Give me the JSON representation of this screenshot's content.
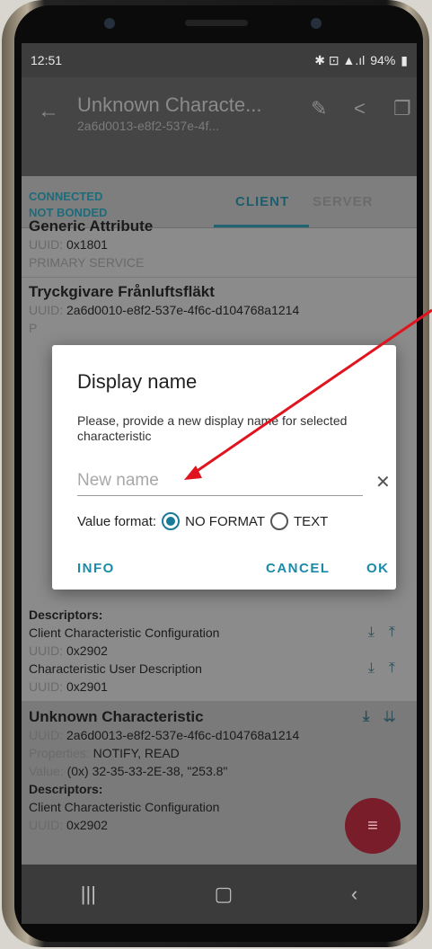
{
  "status": {
    "time": "12:51",
    "battery": "94%"
  },
  "appbar": {
    "title": "Unknown Characte...",
    "subtitle": "2a6d0013-e8f2-537e-4f..."
  },
  "connection": {
    "line1": "CONNECTED",
    "line2": "NOT BONDED"
  },
  "tabs": {
    "client": "CLIENT",
    "server": "SERVER"
  },
  "content": {
    "service1": {
      "name": "Generic Attribute",
      "uuid_label": "UUID:",
      "uuid": "0x1801",
      "type": "PRIMARY SERVICE"
    },
    "service2": {
      "name": "Tryckgivare Frånluftsfläkt",
      "uuid_label": "UUID:",
      "uuid": "2a6d0010-e8f2-537e-4f6c-d104768a1214",
      "type": "P"
    },
    "descriptors_label": "Descriptors:",
    "desc1": {
      "name": "Client Characteristic Configuration",
      "uuid_label": "UUID:",
      "uuid": "0x2902"
    },
    "desc2": {
      "name": "Characteristic User Description",
      "uuid_label": "UUID:",
      "uuid": "0x2901"
    },
    "char3": {
      "name": "Unknown Characteristic",
      "uuid_label": "UUID:",
      "uuid": "2a6d0013-e8f2-537e-4f6c-d104768a1214",
      "props_label": "Properties:",
      "props": "NOTIFY, READ",
      "value_label": "Value:",
      "value": "(0x) 32-35-33-2E-38, \"253.8\"",
      "descriptors_label": "Descriptors:",
      "desc_name": "Client Characteristic Configuration",
      "desc_uuid_label": "UUID:",
      "desc_uuid": "0x2902"
    }
  },
  "dialog": {
    "title": "Display name",
    "message": "Please, provide a new display name for selected characteristic",
    "input_placeholder": "New name",
    "format_label": "Value format:",
    "opt_no_format": "NO FORMAT",
    "opt_text": "TEXT",
    "btn_info": "INFO",
    "btn_cancel": "CANCEL",
    "btn_ok": "OK"
  },
  "colors": {
    "accent": "#1a8aa8",
    "annotation_arrow": "#e0141e",
    "fab": "#7a1d2b"
  },
  "icons": [
    "back-arrow-icon",
    "edit-icon",
    "share-icon",
    "copy-icon",
    "clear-icon",
    "download-icon",
    "upload-icon",
    "multi-arrow-icon",
    "fab-list-icon",
    "nav-recents-icon",
    "nav-home-icon",
    "nav-back-icon"
  ]
}
